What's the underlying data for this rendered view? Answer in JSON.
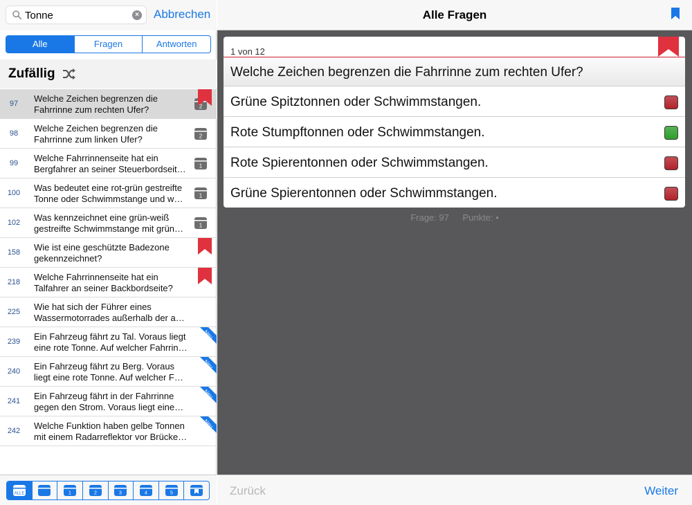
{
  "search": {
    "value": "Tonne",
    "cancel_label": "Abbrechen"
  },
  "filter_tabs": [
    "Alle",
    "Fragen",
    "Antworten"
  ],
  "section": {
    "title": "Zufällig"
  },
  "questions": [
    {
      "num": "97",
      "line1": "Welche Zeichen begrenzen die",
      "line2": "Fahrrinne zum rechten Ufer?",
      "box": "2",
      "bookmark": true,
      "new": false,
      "selected": true
    },
    {
      "num": "98",
      "line1": "Welche Zeichen begrenzen die",
      "line2": "Fahrrinne zum linken Ufer?",
      "box": "2",
      "bookmark": false,
      "new": false
    },
    {
      "num": "99",
      "line1": "Welche Fahrrinnenseite hat ein",
      "line2": "Bergfahrer an seiner Steuerbordseit…",
      "box": "1",
      "bookmark": false,
      "new": false
    },
    {
      "num": "100",
      "line1": "Was bedeutet eine rot-grün gestreifte",
      "line2": "Tonne oder Schwimmstange und w…",
      "box": "1",
      "bookmark": false,
      "new": false
    },
    {
      "num": "102",
      "line1": "Was kennzeichnet eine grün-weiß",
      "line2": "gestreifte Schwimmstange mit grün…",
      "box": "1",
      "bookmark": false,
      "new": false
    },
    {
      "num": "158",
      "line1": "Wie ist eine geschützte Badezone",
      "line2": "gekennzeichnet?",
      "box": "",
      "bookmark": true,
      "new": false
    },
    {
      "num": "218",
      "line1": "Welche Fahrrinnenseite hat ein",
      "line2": "Talfahrer an seiner Backbordseite?",
      "box": "",
      "bookmark": true,
      "new": false
    },
    {
      "num": "225",
      "line1": "Wie hat sich der Führer eines",
      "line2": "Wassermotorrades außerhalb der a…",
      "box": "",
      "bookmark": false,
      "new": false
    },
    {
      "num": "239",
      "line1": "Ein Fahrzeug fährt zu Tal. Voraus liegt",
      "line2": "eine rote Tonne. Auf welcher Fahrrin…",
      "box": "",
      "bookmark": false,
      "new": true
    },
    {
      "num": "240",
      "line1": "Ein Fahrzeug fährt zu Berg. Voraus",
      "line2": "liegt eine rote Tonne. Auf welcher F…",
      "box": "",
      "bookmark": false,
      "new": true
    },
    {
      "num": "241",
      "line1": "Ein Fahrzeug fährt in der Fahrrinne",
      "line2": "gegen den Strom. Voraus liegt eine…",
      "box": "",
      "bookmark": false,
      "new": true
    },
    {
      "num": "242",
      "line1": "Welche Funktion haben gelbe Tonnen",
      "line2": "mit einem Radarreflektor vor Brücke…",
      "box": "",
      "bookmark": false,
      "new": true
    }
  ],
  "new_label": "Neu",
  "box_tabs": [
    "ALLE",
    "",
    "1",
    "2",
    "3",
    "4",
    "5",
    ""
  ],
  "nav": {
    "title": "Alle Fragen"
  },
  "card": {
    "counter": "1 von 12",
    "question": "Welche Zeichen begrenzen die Fahrrinne zum rechten Ufer?",
    "answers": [
      {
        "text": "Grüne Spitztonnen oder Schwimmstangen.",
        "color": "#b3222a"
      },
      {
        "text": "Rote Stumpftonnen oder Schwimmstangen.",
        "color": "#2e9e2a"
      },
      {
        "text": "Rote Spierentonnen oder Schwimmstangen.",
        "color": "#b3222a"
      },
      {
        "text": "Grüne Spierentonnen oder Schwimmstangen.",
        "color": "#b3222a"
      }
    ]
  },
  "status": {
    "frage": "Frage: 97",
    "punkte": "Punkte: •"
  },
  "footer": {
    "back_label": "Zurück",
    "next_label": "Weiter"
  },
  "colors": {
    "accent": "#1a78e6",
    "bookmark": "#e0323e",
    "new_ribbon": "#1a78e6",
    "correct": "#2e9e2a",
    "wrong": "#b3222a"
  }
}
